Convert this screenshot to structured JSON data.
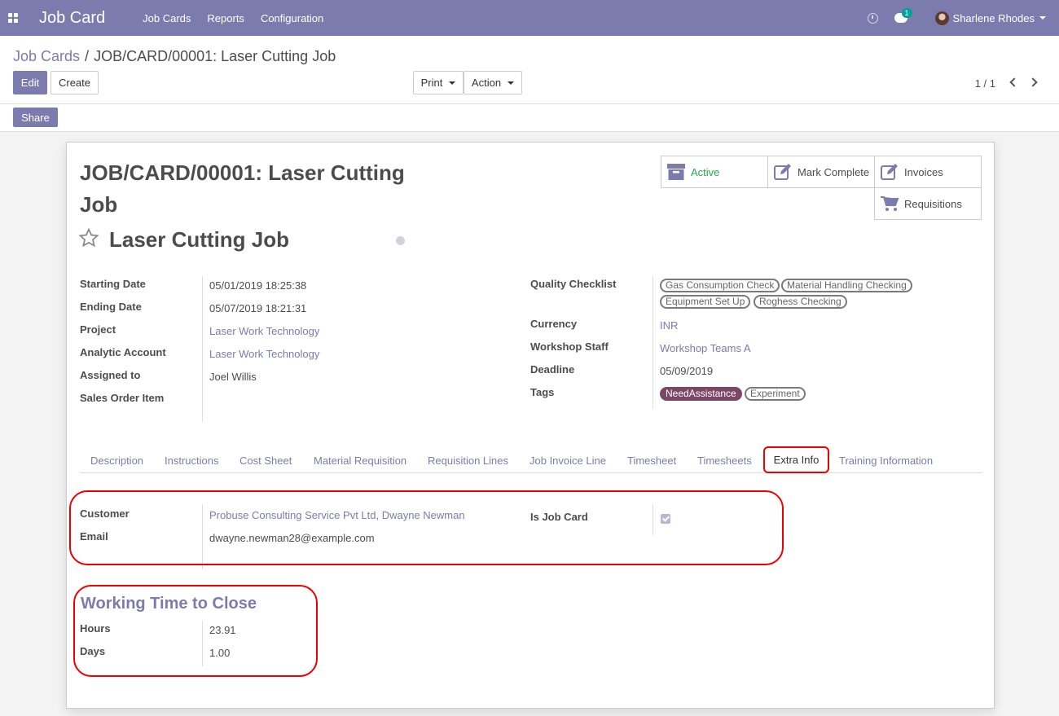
{
  "navbar": {
    "app_title": "Job Card",
    "menu": [
      "Job Cards",
      "Reports",
      "Configuration"
    ],
    "chat_count": "1",
    "user_name": "Sharlene Rhodes"
  },
  "breadcrumb": {
    "parent": "Job Cards",
    "separator": "/",
    "current": "JOB/CARD/00001: Laser Cutting Job"
  },
  "toolbar": {
    "edit_label": "Edit",
    "create_label": "Create",
    "print_label": "Print",
    "action_label": "Action",
    "pager": "1 / 1",
    "share_label": "Share"
  },
  "record": {
    "title": "JOB/CARD/00001: Laser Cutting Job",
    "name": "Laser Cutting Job"
  },
  "smart_buttons": {
    "active": "Active",
    "mark_complete": "Mark Complete",
    "invoices": "Invoices",
    "requisitions": "Requisitions"
  },
  "left_fields": {
    "starting_date_label": "Starting Date",
    "starting_date": "05/01/2019 18:25:38",
    "ending_date_label": "Ending Date",
    "ending_date": "05/07/2019 18:21:31",
    "project_label": "Project",
    "project": "Laser Work Technology",
    "analytic_label": "Analytic Account",
    "analytic": "Laser Work Technology",
    "assigned_label": "Assigned to",
    "assigned": "Joel Willis",
    "sales_order_item_label": "Sales Order Item"
  },
  "right_fields": {
    "quality_label": "Quality Checklist",
    "quality_tags": [
      "Gas Consumption Check",
      "Material Handling Checking",
      "Equipment Set Up",
      "Roghess Checking"
    ],
    "currency_label": "Currency",
    "currency": "INR",
    "staff_label": "Workshop Staff",
    "staff": "Workshop Teams A",
    "deadline_label": "Deadline",
    "deadline": "05/09/2019",
    "tags_label": "Tags",
    "tags": [
      "NeedAssistance",
      "Experiment"
    ]
  },
  "tabs": [
    "Description",
    "Instructions",
    "Cost Sheet",
    "Material Requisition",
    "Requisition Lines",
    "Job Invoice Line",
    "Timesheet",
    "Timesheets",
    "Extra Info",
    "Training Information"
  ],
  "extra_info": {
    "customer_label": "Customer",
    "customer": "Probuse Consulting Service Pvt Ltd, Dwayne Newman",
    "email_label": "Email",
    "email": "dwayne.newman28@example.com",
    "is_job_card_label": "Is Job Card",
    "is_job_card": true
  },
  "working_time": {
    "title": "Working Time to Close",
    "hours_label": "Hours",
    "hours": "23.91",
    "days_label": "Days",
    "days": "1.00"
  },
  "colors": {
    "brand": "#7c7bad",
    "active_green": "#28a745",
    "tag_filled": "#7c4766",
    "highlight_red": "#ee0000"
  }
}
